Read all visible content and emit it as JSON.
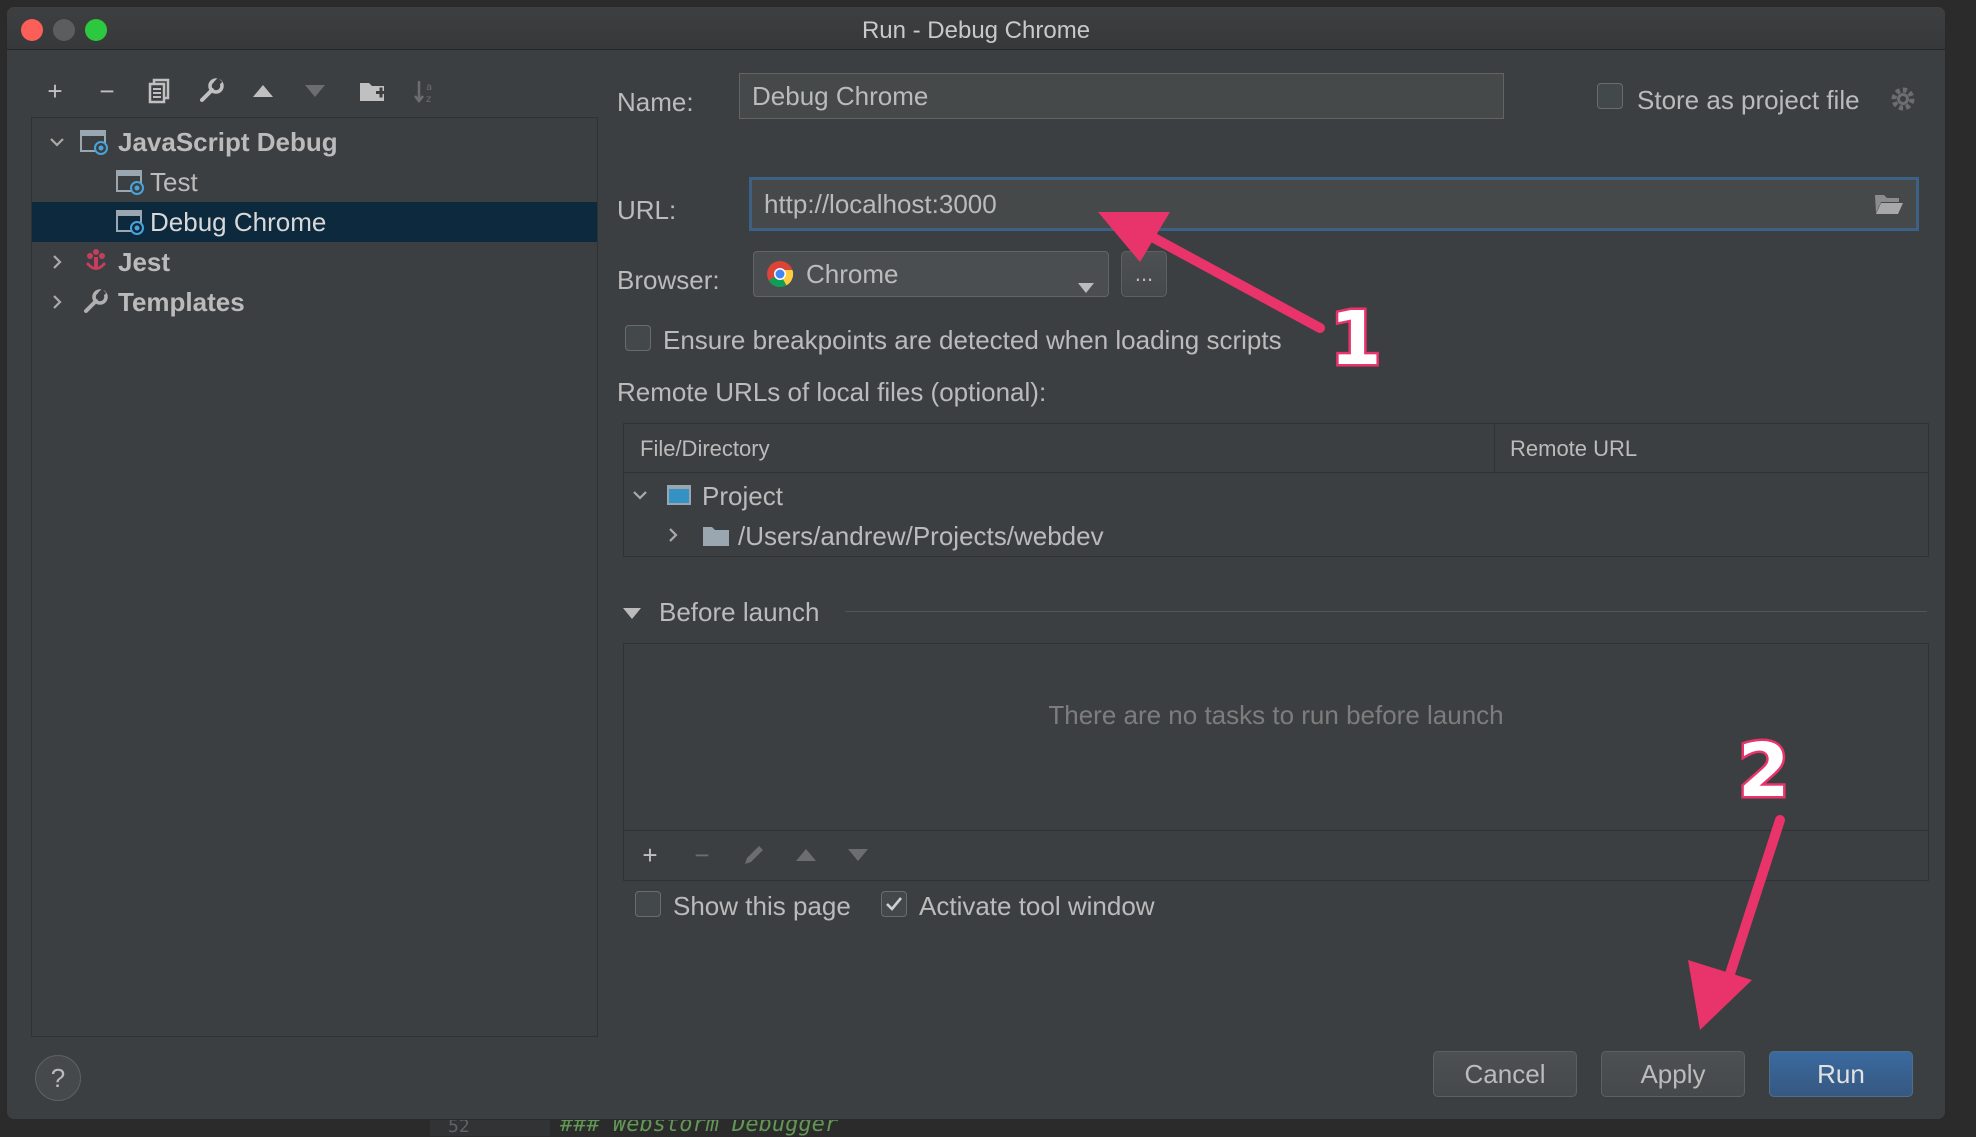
{
  "window": {
    "title": "Run - Debug Chrome"
  },
  "background": {
    "line_number": "52",
    "code_line": "### Webstorm Debugger"
  },
  "toolbar": {
    "icons": [
      "add-icon",
      "remove-icon",
      "copy-icon",
      "wrench-icon",
      "move-up-icon",
      "move-down-icon",
      "new-folder-icon",
      "sort-icon"
    ]
  },
  "tree": {
    "items": [
      {
        "label": "JavaScript Debug",
        "expanded": true,
        "bold": true
      },
      {
        "label": "Test"
      },
      {
        "label": "Debug Chrome",
        "selected": true
      },
      {
        "label": "Jest",
        "expanded": false,
        "bold": true
      },
      {
        "label": "Templates",
        "expanded": false,
        "bold": true
      }
    ]
  },
  "form": {
    "name_label": "Name:",
    "name_value": "Debug Chrome",
    "store_label": "Store as project file",
    "url_label": "URL:",
    "url_value": "http://localhost:3000",
    "browser_label": "Browser:",
    "browser_value": "Chrome",
    "browser_more": "...",
    "ensure_label": "Ensure breakpoints are detected when loading scripts",
    "remote_label": "Remote URLs of local files (optional):"
  },
  "mapping_table": {
    "columns": [
      "File/Directory",
      "Remote URL"
    ],
    "rows": [
      {
        "label": "Project",
        "expanded": true
      },
      {
        "label": "/Users/andrew/Projects/webdev",
        "expanded": false
      }
    ]
  },
  "before_launch": {
    "title": "Before launch",
    "empty_text": "There are no tasks to run before launch",
    "show_page_label": "Show this page",
    "show_page_checked": false,
    "activate_label": "Activate tool window",
    "activate_checked": true
  },
  "buttons": {
    "help": "?",
    "cancel": "Cancel",
    "apply": "Apply",
    "run": "Run"
  },
  "annotations": {
    "one": "1",
    "two": "2",
    "color": "#e8336b"
  },
  "colors": {
    "dialog_bg": "#3c3f41",
    "selection_bg": "#0d293e",
    "primary_button": "#365880"
  }
}
